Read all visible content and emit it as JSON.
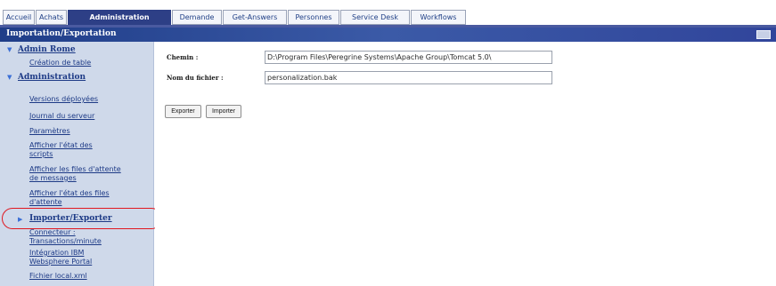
{
  "tabs": [
    {
      "label": "Accueil",
      "active": false
    },
    {
      "label": "Achats",
      "active": false
    },
    {
      "label": "Administration",
      "active": true
    },
    {
      "label": "Demande",
      "active": false
    },
    {
      "label": "Get-Answers",
      "active": false
    },
    {
      "label": "Personnes",
      "active": false
    },
    {
      "label": "Service Desk",
      "active": false
    },
    {
      "label": "Workflows",
      "active": false
    }
  ],
  "header": {
    "title": "Importation/Exportation"
  },
  "sidebar": {
    "sections": [
      {
        "title": "Admin Rome",
        "items": [
          "Création de table"
        ]
      },
      {
        "title": "Administration",
        "items": [
          "Versions déployées",
          "Journal du serveur",
          "Paramètres",
          "Afficher l'état des scripts",
          "Afficher les files d'attente de messages",
          "Afficher l'état des files d'attente",
          "Importer/Exporter",
          "Connecteur : Transactions/minute",
          "Intégration IBM Websphere Portal",
          "Fichier local.xml"
        ]
      }
    ],
    "current_item": "Importer/Exporter"
  },
  "form": {
    "path_label": "Chemin :",
    "path_value": "D:\\Program Files\\Peregrine Systems\\Apache Group\\Tomcat 5.0\\",
    "filename_label": "Nom du fichier :",
    "filename_value": "personalization.bak",
    "export_label": "Exporter",
    "import_label": "Importer"
  },
  "colors": {
    "accent": "#2d3f86",
    "sidebar_bg": "#cfd9ea",
    "highlight": "#e0171f"
  }
}
